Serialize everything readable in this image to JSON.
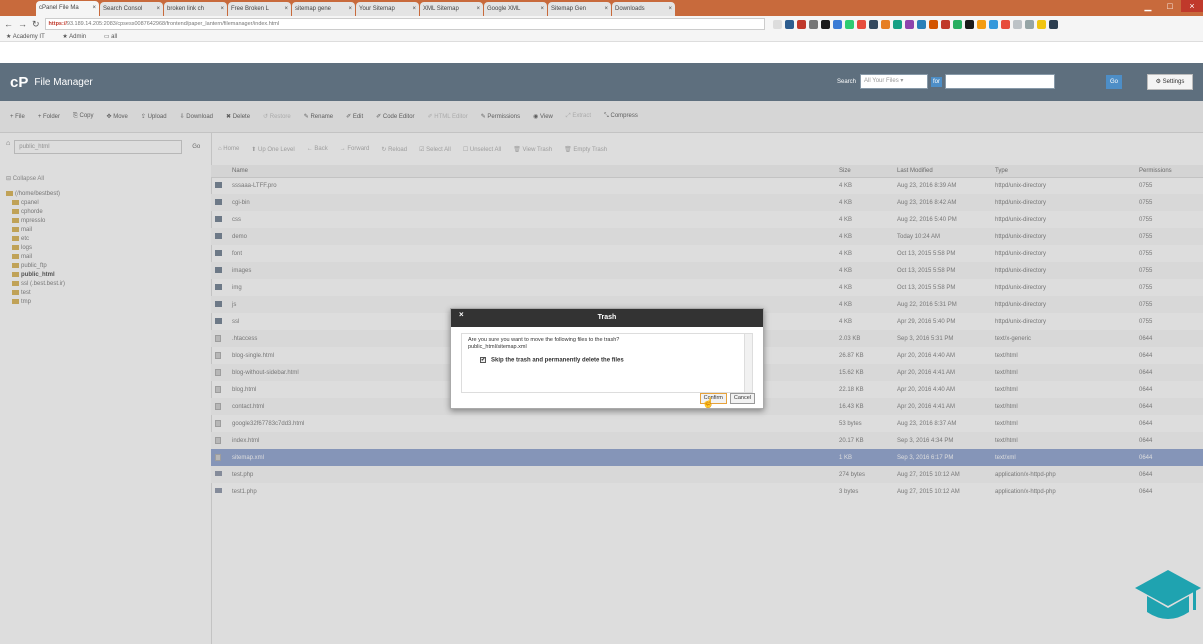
{
  "browser": {
    "tabs": [
      {
        "label": "cPanel File Ma",
        "active": true
      },
      {
        "label": "Search Consol",
        "active": false
      },
      {
        "label": "broken link ch",
        "active": false
      },
      {
        "label": "Free Broken L",
        "active": false
      },
      {
        "label": "sitemap gene",
        "active": false
      },
      {
        "label": "Your Sitemap",
        "active": false
      },
      {
        "label": "XML Sitemap",
        "active": false
      },
      {
        "label": "Google XML",
        "active": false
      },
      {
        "label": "Sitemap Gen",
        "active": false
      },
      {
        "label": "Downloads",
        "active": false
      }
    ],
    "url_prefix": "https://",
    "url_rest": "93.189.14.205:2083/cpsess0087642968/frontend/paper_lantern/filemanager/index.html",
    "bookmarks": [
      "Academy IT",
      "Admin",
      "all"
    ],
    "close_glyph": "×",
    "minimize_glyph": "▁",
    "maximize_glyph": "□"
  },
  "header": {
    "logo": "cP",
    "title": "File Manager",
    "search_label": "Search",
    "search_scope": "All Your Files",
    "for_label": "for",
    "go_label": "Go",
    "settings_label": "⚙ Settings"
  },
  "toolbar": [
    {
      "label": "+ File",
      "disabled": false
    },
    {
      "label": "+ Folder",
      "disabled": false
    },
    {
      "label": "⎘ Copy",
      "disabled": false
    },
    {
      "label": "✥ Move",
      "disabled": false
    },
    {
      "label": "⇪ Upload",
      "disabled": false
    },
    {
      "label": "⇩ Download",
      "disabled": false
    },
    {
      "label": "✖ Delete",
      "disabled": false
    },
    {
      "label": "↺ Restore",
      "disabled": true
    },
    {
      "label": "✎ Rename",
      "disabled": false
    },
    {
      "label": "✐ Edit",
      "disabled": false
    },
    {
      "label": "✐ Code Editor",
      "disabled": false
    },
    {
      "label": "✐ HTML Editor",
      "disabled": true
    },
    {
      "label": "✎ Permissions",
      "disabled": false
    },
    {
      "label": "◉ View",
      "disabled": false
    },
    {
      "label": "⤢ Extract",
      "disabled": true
    },
    {
      "label": "⤡ Compress",
      "disabled": false
    }
  ],
  "left_pane": {
    "path": "public_html",
    "path_go": "Go",
    "collapse_all": "⊟ Collapse All",
    "tree": [
      {
        "label": "(/home/bestbest)",
        "bold": false,
        "indent": 0
      },
      {
        "label": "cpanel",
        "bold": false,
        "indent": 1
      },
      {
        "label": "cphorde",
        "bold": false,
        "indent": 1
      },
      {
        "label": "mpresslo",
        "bold": false,
        "indent": 1
      },
      {
        "label": "mail",
        "bold": false,
        "indent": 1
      },
      {
        "label": "etc",
        "bold": false,
        "indent": 1
      },
      {
        "label": "logs",
        "bold": false,
        "indent": 1
      },
      {
        "label": "mail",
        "bold": false,
        "indent": 1
      },
      {
        "label": "public_ftp",
        "bold": false,
        "indent": 1
      },
      {
        "label": "public_html",
        "bold": true,
        "indent": 1
      },
      {
        "label": "ssl (.best.best.ir)",
        "bold": false,
        "indent": 1
      },
      {
        "label": "test",
        "bold": false,
        "indent": 1
      },
      {
        "label": "tmp",
        "bold": false,
        "indent": 1
      }
    ]
  },
  "nav_buttons": [
    "⌂ Home",
    "⬆ Up One Level",
    "← Back",
    "→ Forward",
    "↻ Reload",
    "☑ Select All",
    "☐ Unselect All",
    "🗑 View Trash",
    "🗑 Empty Trash"
  ],
  "table": {
    "headers": [
      "Name",
      "Size",
      "Last Modified",
      "Type",
      "Permissions"
    ],
    "rows": [
      {
        "icon": "dir",
        "name": "sssaaa-LTFF.pro",
        "size": "4 KB",
        "modified": "Aug 23, 2016 8:39 AM",
        "type": "httpd/unix-directory",
        "perms": "0755",
        "selected": false
      },
      {
        "icon": "dir",
        "name": "cgi-bin",
        "size": "4 KB",
        "modified": "Aug 23, 2016 8:42 AM",
        "type": "httpd/unix-directory",
        "perms": "0755",
        "selected": false
      },
      {
        "icon": "dir",
        "name": "css",
        "size": "4 KB",
        "modified": "Aug 22, 2016 5:40 PM",
        "type": "httpd/unix-directory",
        "perms": "0755",
        "selected": false
      },
      {
        "icon": "dir",
        "name": "demo",
        "size": "4 KB",
        "modified": "Today 10:24 AM",
        "type": "httpd/unix-directory",
        "perms": "0755",
        "selected": false
      },
      {
        "icon": "dir",
        "name": "font",
        "size": "4 KB",
        "modified": "Oct 13, 2015 5:58 PM",
        "type": "httpd/unix-directory",
        "perms": "0755",
        "selected": false
      },
      {
        "icon": "dir",
        "name": "images",
        "size": "4 KB",
        "modified": "Oct 13, 2015 5:58 PM",
        "type": "httpd/unix-directory",
        "perms": "0755",
        "selected": false
      },
      {
        "icon": "dir",
        "name": "img",
        "size": "4 KB",
        "modified": "Oct 13, 2015 5:58 PM",
        "type": "httpd/unix-directory",
        "perms": "0755",
        "selected": false
      },
      {
        "icon": "dir",
        "name": "js",
        "size": "4 KB",
        "modified": "Aug 22, 2016 5:31 PM",
        "type": "httpd/unix-directory",
        "perms": "0755",
        "selected": false
      },
      {
        "icon": "dir",
        "name": "ssl",
        "size": "4 KB",
        "modified": "Apr 29, 2016 5:40 PM",
        "type": "httpd/unix-directory",
        "perms": "0755",
        "selected": false
      },
      {
        "icon": "file",
        "name": ".htaccess",
        "size": "2.03 KB",
        "modified": "Sep 3, 2016 5:31 PM",
        "type": "text/x-generic",
        "perms": "0644",
        "selected": false
      },
      {
        "icon": "file",
        "name": "blog-single.html",
        "size": "26.87 KB",
        "modified": "Apr 20, 2016 4:40 AM",
        "type": "text/html",
        "perms": "0644",
        "selected": false
      },
      {
        "icon": "file",
        "name": "blog-without-sidebar.html",
        "size": "15.62 KB",
        "modified": "Apr 20, 2016 4:41 AM",
        "type": "text/html",
        "perms": "0644",
        "selected": false
      },
      {
        "icon": "file",
        "name": "blog.html",
        "size": "22.18 KB",
        "modified": "Apr 20, 2016 4:40 AM",
        "type": "text/html",
        "perms": "0644",
        "selected": false
      },
      {
        "icon": "file",
        "name": "contact.html",
        "size": "16.43 KB",
        "modified": "Apr 20, 2016 4:41 AM",
        "type": "text/html",
        "perms": "0644",
        "selected": false
      },
      {
        "icon": "file",
        "name": "google32f67783c7dd3.html",
        "size": "53 bytes",
        "modified": "Aug 23, 2016 8:37 AM",
        "type": "text/html",
        "perms": "0644",
        "selected": false
      },
      {
        "icon": "file",
        "name": "index.html",
        "size": "20.17 KB",
        "modified": "Sep 3, 2016 4:34 PM",
        "type": "text/html",
        "perms": "0644",
        "selected": false
      },
      {
        "icon": "file",
        "name": "sitemap.xml",
        "size": "1 KB",
        "modified": "Sep 3, 2016 6:17 PM",
        "type": "text/xml",
        "perms": "0644",
        "selected": true
      },
      {
        "icon": "php",
        "name": "test.php",
        "size": "274 bytes",
        "modified": "Aug 27, 2015 10:12 AM",
        "type": "application/x-httpd-php",
        "perms": "0644",
        "selected": false
      },
      {
        "icon": "php",
        "name": "test1.php",
        "size": "3 bytes",
        "modified": "Aug 27, 2015 10:12 AM",
        "type": "application/x-httpd-php",
        "perms": "0644",
        "selected": false
      }
    ]
  },
  "dialog": {
    "title": "Trash",
    "close": "×",
    "question": "Are you sure you want to move the following files to the trash?",
    "file": "public_html/sitemap.xml",
    "skip_label": "Skip the trash and permanently delete the files",
    "checkbox_mark": "✔",
    "confirm_label": "Confirm",
    "cancel_label": "Cancel"
  },
  "colors": {
    "header_bg": "#5e6f7e",
    "selected_row": "#8a9fce",
    "dialog_header": "#333333"
  }
}
